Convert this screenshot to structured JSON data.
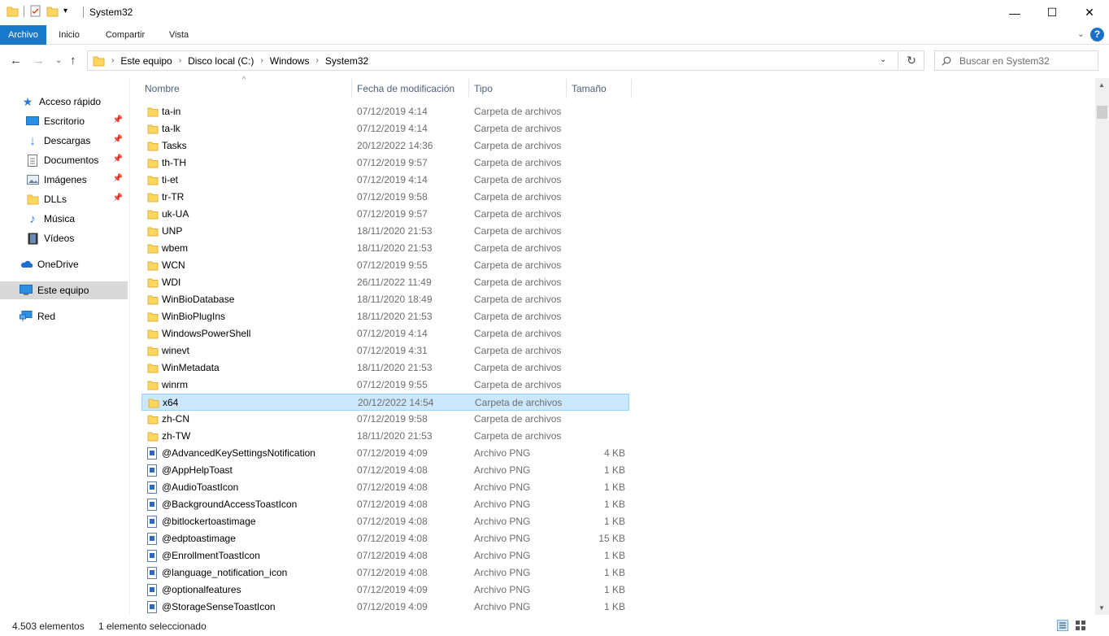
{
  "window": {
    "title": "System32",
    "minimize": "—",
    "maximize": "☐",
    "close": "✕"
  },
  "ribbon": {
    "tabs": [
      "Archivo",
      "Inicio",
      "Compartir",
      "Vista"
    ],
    "help": "?"
  },
  "address": {
    "crumbs": [
      "Este equipo",
      "Disco local (C:)",
      "Windows",
      "System32"
    ],
    "search_placeholder": "Buscar en System32"
  },
  "navpane": {
    "quick_access": "Acceso rápido",
    "items": [
      "Escritorio",
      "Descargas",
      "Documentos",
      "Imágenes",
      "DLLs",
      "Música",
      "Vídeos"
    ],
    "onedrive": "OneDrive",
    "this_pc": "Este equipo",
    "network": "Red"
  },
  "columns": {
    "name": "Nombre",
    "date": "Fecha de modificación",
    "type": "Tipo",
    "size": "Tamaño"
  },
  "files": [
    {
      "name": "ta-in",
      "date": "07/12/2019 4:14",
      "type": "Carpeta de archivos",
      "size": "",
      "kind": "folder"
    },
    {
      "name": "ta-lk",
      "date": "07/12/2019 4:14",
      "type": "Carpeta de archivos",
      "size": "",
      "kind": "folder"
    },
    {
      "name": "Tasks",
      "date": "20/12/2022 14:36",
      "type": "Carpeta de archivos",
      "size": "",
      "kind": "folder"
    },
    {
      "name": "th-TH",
      "date": "07/12/2019 9:57",
      "type": "Carpeta de archivos",
      "size": "",
      "kind": "folder"
    },
    {
      "name": "ti-et",
      "date": "07/12/2019 4:14",
      "type": "Carpeta de archivos",
      "size": "",
      "kind": "folder"
    },
    {
      "name": "tr-TR",
      "date": "07/12/2019 9:58",
      "type": "Carpeta de archivos",
      "size": "",
      "kind": "folder"
    },
    {
      "name": "uk-UA",
      "date": "07/12/2019 9:57",
      "type": "Carpeta de archivos",
      "size": "",
      "kind": "folder"
    },
    {
      "name": "UNP",
      "date": "18/11/2020 21:53",
      "type": "Carpeta de archivos",
      "size": "",
      "kind": "folder"
    },
    {
      "name": "wbem",
      "date": "18/11/2020 21:53",
      "type": "Carpeta de archivos",
      "size": "",
      "kind": "folder"
    },
    {
      "name": "WCN",
      "date": "07/12/2019 9:55",
      "type": "Carpeta de archivos",
      "size": "",
      "kind": "folder"
    },
    {
      "name": "WDI",
      "date": "26/11/2022 11:49",
      "type": "Carpeta de archivos",
      "size": "",
      "kind": "folder"
    },
    {
      "name": "WinBioDatabase",
      "date": "18/11/2020 18:49",
      "type": "Carpeta de archivos",
      "size": "",
      "kind": "folder"
    },
    {
      "name": "WinBioPlugIns",
      "date": "18/11/2020 21:53",
      "type": "Carpeta de archivos",
      "size": "",
      "kind": "folder"
    },
    {
      "name": "WindowsPowerShell",
      "date": "07/12/2019 4:14",
      "type": "Carpeta de archivos",
      "size": "",
      "kind": "folder"
    },
    {
      "name": "winevt",
      "date": "07/12/2019 4:31",
      "type": "Carpeta de archivos",
      "size": "",
      "kind": "folder"
    },
    {
      "name": "WinMetadata",
      "date": "18/11/2020 21:53",
      "type": "Carpeta de archivos",
      "size": "",
      "kind": "folder"
    },
    {
      "name": "winrm",
      "date": "07/12/2019 9:55",
      "type": "Carpeta de archivos",
      "size": "",
      "kind": "folder"
    },
    {
      "name": "x64",
      "date": "20/12/2022 14:54",
      "type": "Carpeta de archivos",
      "size": "",
      "kind": "folder",
      "selected": true
    },
    {
      "name": "zh-CN",
      "date": "07/12/2019 9:58",
      "type": "Carpeta de archivos",
      "size": "",
      "kind": "folder"
    },
    {
      "name": "zh-TW",
      "date": "18/11/2020 21:53",
      "type": "Carpeta de archivos",
      "size": "",
      "kind": "folder"
    },
    {
      "name": "@AdvancedKeySettingsNotification",
      "date": "07/12/2019 4:09",
      "type": "Archivo PNG",
      "size": "4 KB",
      "kind": "png"
    },
    {
      "name": "@AppHelpToast",
      "date": "07/12/2019 4:08",
      "type": "Archivo PNG",
      "size": "1 KB",
      "kind": "png"
    },
    {
      "name": "@AudioToastIcon",
      "date": "07/12/2019 4:08",
      "type": "Archivo PNG",
      "size": "1 KB",
      "kind": "png"
    },
    {
      "name": "@BackgroundAccessToastIcon",
      "date": "07/12/2019 4:08",
      "type": "Archivo PNG",
      "size": "1 KB",
      "kind": "png"
    },
    {
      "name": "@bitlockertoastimage",
      "date": "07/12/2019 4:08",
      "type": "Archivo PNG",
      "size": "1 KB",
      "kind": "png"
    },
    {
      "name": "@edptoastimage",
      "date": "07/12/2019 4:08",
      "type": "Archivo PNG",
      "size": "15 KB",
      "kind": "png"
    },
    {
      "name": "@EnrollmentToastIcon",
      "date": "07/12/2019 4:08",
      "type": "Archivo PNG",
      "size": "1 KB",
      "kind": "png"
    },
    {
      "name": "@language_notification_icon",
      "date": "07/12/2019 4:08",
      "type": "Archivo PNG",
      "size": "1 KB",
      "kind": "png"
    },
    {
      "name": "@optionalfeatures",
      "date": "07/12/2019 4:09",
      "type": "Archivo PNG",
      "size": "1 KB",
      "kind": "png"
    },
    {
      "name": "@StorageSenseToastIcon",
      "date": "07/12/2019 4:09",
      "type": "Archivo PNG",
      "size": "1 KB",
      "kind": "png"
    }
  ],
  "status": {
    "count": "4.503 elementos",
    "selection": "1 elemento seleccionado"
  },
  "colors": {
    "accent": "#1979ca",
    "selection_bg": "#cce8ff",
    "folder": "#ffd75e"
  }
}
